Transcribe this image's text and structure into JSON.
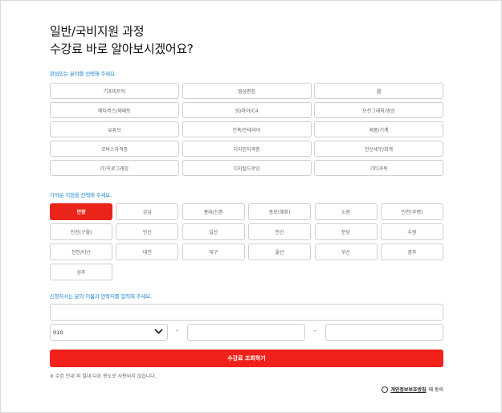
{
  "header": {
    "line1": "일반/국비지원 과정",
    "line2": "수강료 바로 알아보시겠어요?"
  },
  "interest": {
    "label": "관심있는 분야를 선택해 주세요.",
    "options": [
      "기초마트틱",
      "영상편집",
      "웹",
      "메타버스/제페토",
      "3D마야/C4",
      "모션그래픽/영상",
      "유튜브",
      "건축/인테리어",
      "제품/기계",
      "모바스자격증",
      "디자인자격증",
      "전산세무/회계",
      "IT/프로그래밍",
      "디지털드로잉",
      "기타과목"
    ]
  },
  "branch": {
    "label": "가까운 지점을 선택해 주세요.",
    "selected": "연향",
    "options": [
      "연향",
      "강남",
      "홍대/신촌",
      "종로(혜화)",
      "노원",
      "인천(부평)",
      "인천(구월)",
      "인신",
      "일산",
      "안산",
      "분당",
      "수원",
      "천안/아산",
      "대전",
      "대구",
      "울산",
      "부산",
      "광주",
      "성주"
    ]
  },
  "contact": {
    "label": "신청하시는 분의 이름과 연락처를 입력해 주세요.",
    "name_placeholder": "",
    "phone_prefix": "010",
    "dash": "-",
    "phone_mid": "",
    "phone_last": ""
  },
  "submit_label": "수강료 조회하기",
  "notice": "※ 수강 안내 외 절대 다른 용도로 사용되지 않습니다.",
  "agree": {
    "link_text": "개인정보보호방침",
    "suffix": "에 동의"
  },
  "colors": {
    "accent": "#f2211a",
    "selected": "#ea2419",
    "label_blue": "#1d86d8"
  }
}
